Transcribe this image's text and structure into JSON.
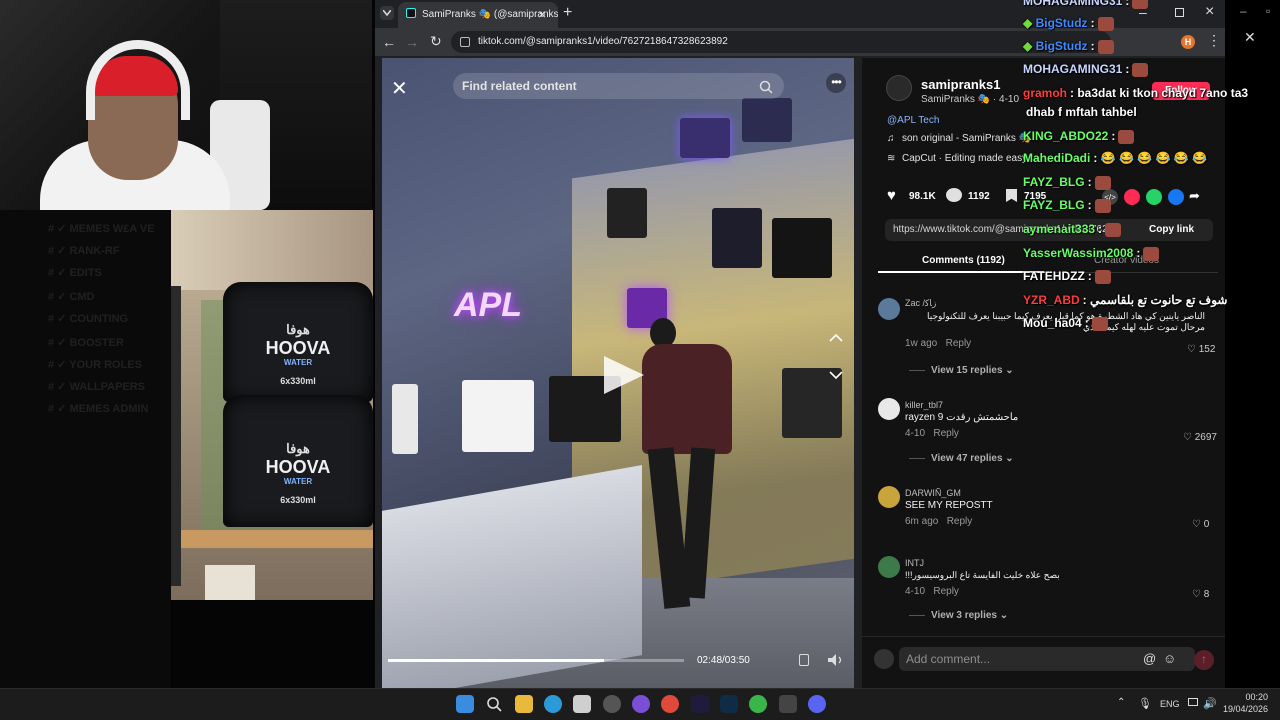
{
  "browser": {
    "tab_title": "SamiPranks 🎭 (@samipranks1",
    "url": "tiktok.com/@samipranks1/video/7627218647328623892",
    "profile_initial": "H"
  },
  "video": {
    "search_placeholder": "Find related content",
    "neon_sign": "APL",
    "time": "02:48/03:50",
    "progress": 0.73
  },
  "ad": {
    "brand_ar": "هوفا",
    "brand": "HOOVA",
    "sub": "WATER",
    "size": "6x330ml"
  },
  "panel": {
    "username": "samipranks1",
    "display": "SamiPranks 🎭 · 4-10",
    "follow": "Follow",
    "mention": "@APL Tech",
    "sound": "son original - SamiPranks 🎭",
    "capcut": "CapCut · Editing made easy",
    "likes": "98.1K",
    "comments": "1192",
    "shares": "7195",
    "link": "https://www.tiktok.com/@samipranks1/video/762...",
    "copy_link": "Copy link",
    "tab_comments": "Comments (1192)",
    "tab_creator": "Creator videos",
    "add_comment": "Add comment..."
  },
  "comments": [
    {
      "user": "Zac /ﺯﺎﻛ",
      "text": "الناصر ياينين كي هاد الشطرة هو كما قيل يعرف كيما حبيبنا يعرف للتكنولوجيا مرحال تموت عليه لهله كيما هاذي",
      "date": "1w ago",
      "reply": "Reply",
      "likes": "152",
      "replies": "View 15 replies"
    },
    {
      "user": "killer_tbl7",
      "text": "rayzen 9 ماحشمتش رقدت",
      "date": "4-10",
      "reply": "Reply",
      "likes": "2697",
      "replies": "View 47 replies"
    },
    {
      "user": "DARWIÑ_GM",
      "text": "SEE MY REPOSTT",
      "date": "6m ago",
      "reply": "Reply",
      "likes": "0",
      "replies": ""
    },
    {
      "user": "INTJ",
      "text": "!!!بصح علاه خليت الفايسة تاع البروسيسور",
      "date": "4-10",
      "reply": "Reply",
      "likes": "8",
      "replies": "View 3 replies"
    }
  ],
  "chat": [
    {
      "user": "MOHAGAMING31",
      "color": "#c8d6ff",
      "msg": ":"
    },
    {
      "user": "BigStudz",
      "color": "#3d8bff",
      "msg": ":"
    },
    {
      "user": "BigStudz",
      "color": "#3d8bff",
      "msg": ":"
    },
    {
      "user": "MOHAGAMING31",
      "color": "#c8d6ff",
      "msg": ":"
    },
    {
      "user": "gramoh",
      "color": "#ff3b3b",
      "msg": ": ba3dat ki tkon chayd 7ano ta3"
    },
    {
      "user": "",
      "color": "#ffffff",
      "msg": "dhab f mftah tahbel"
    },
    {
      "user": "KING_ABDO22",
      "color": "#66ff66",
      "msg": ":"
    },
    {
      "user": "MahediDadi",
      "color": "#66ff66",
      "msg": ": 😂 😂 😂 😂 😂 😂"
    },
    {
      "user": "FAYZ_BLG",
      "color": "#66ff66",
      "msg": ":"
    },
    {
      "user": "FAYZ_BLG",
      "color": "#66ff66",
      "msg": ":"
    },
    {
      "user": "aymenait333",
      "color": "#66ff66",
      "msg": ":"
    },
    {
      "user": "YasserWassim2008",
      "color": "#66ff66",
      "msg": ":"
    },
    {
      "user": "FATEHDZZ",
      "color": "#ffffff",
      "msg": ":"
    },
    {
      "user": "YZR_ABD",
      "color": "#ff3b3b",
      "msg": ": شوف تع حانوت تع بلقاسمي"
    },
    {
      "user": "Mou_ha04",
      "color": "#ffffff",
      "msg": ":"
    }
  ],
  "discord_channels": [
    "# ✓ MEMES W£A VE",
    "# ✓ RANK-RF",
    "# ✓ EDITS",
    "# ✓ CMD",
    "# ✓ COUNTING",
    "# ✓ BOOSTER",
    "# ✓ YOUR ROLES",
    "# ✓ WALLPAPERS",
    "# ✓ MEMES ADMIN"
  ],
  "taskbar": {
    "lang": "ENG",
    "time": "00:20",
    "date": "19/04/2026"
  },
  "colors": {
    "tiktok_red": "#fe2c55",
    "panel_bg": "#121212",
    "browser_bg": "#202124"
  }
}
